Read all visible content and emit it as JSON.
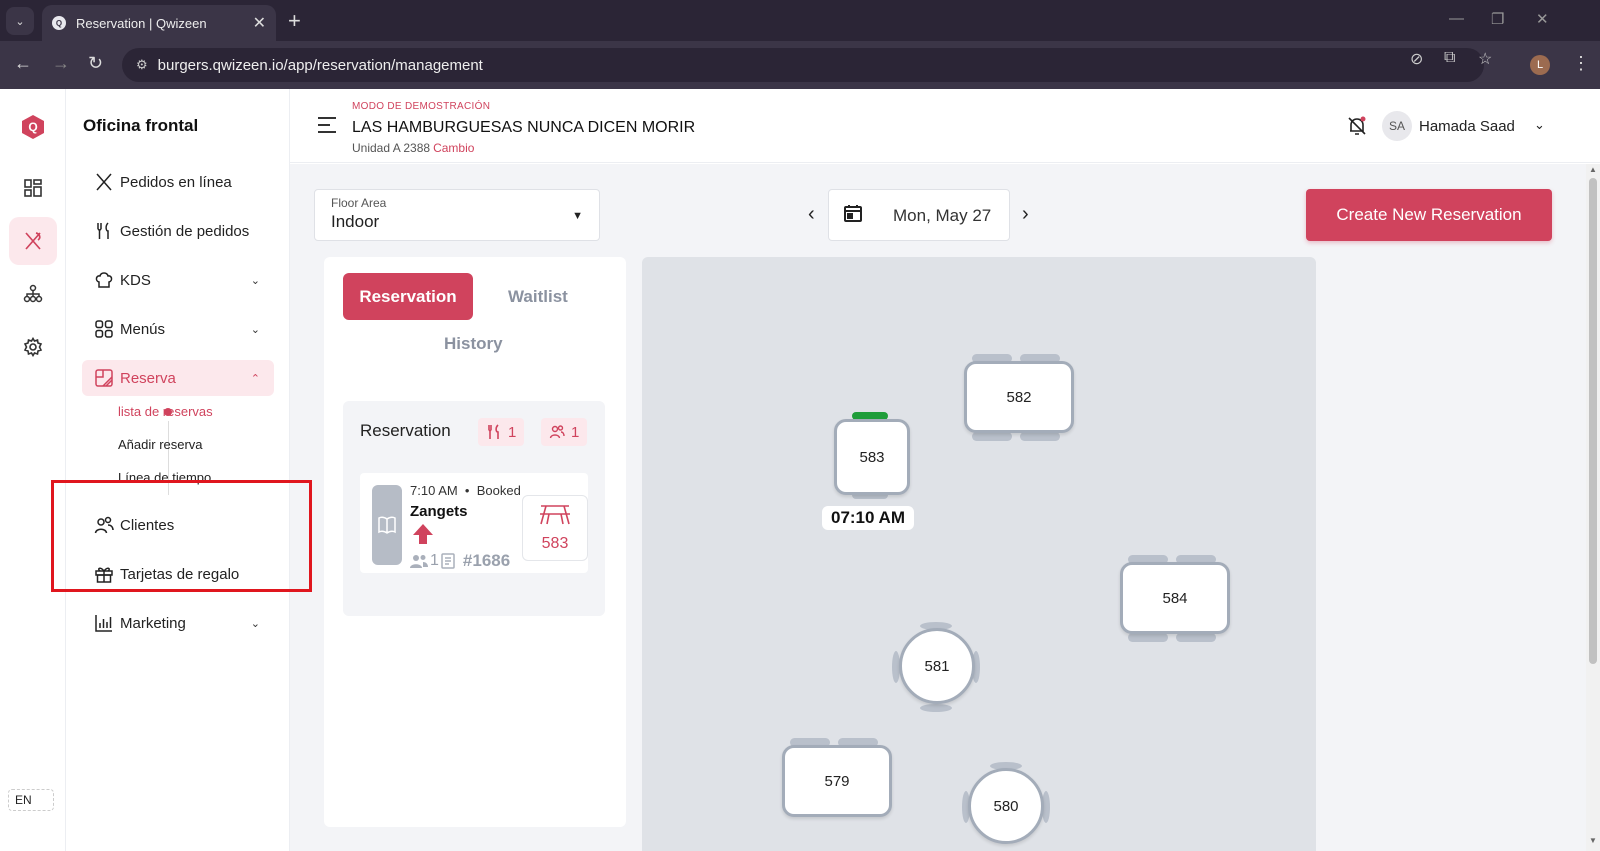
{
  "browser": {
    "tab_title": "Reservation | Qwizeen",
    "url": "burgers.qwizeen.io/app/reservation/management",
    "profile_initial": "L"
  },
  "rail": {
    "logo": "Q",
    "lang": "EN"
  },
  "sidenav": {
    "title": "Oficina frontal",
    "items": [
      {
        "label": "Pedidos en línea"
      },
      {
        "label": "Gestión de pedidos"
      },
      {
        "label": "KDS"
      },
      {
        "label": "Menús"
      },
      {
        "label": "Reserva"
      },
      {
        "label": "Clientes"
      },
      {
        "label": "Tarjetas de regalo"
      },
      {
        "label": "Marketing"
      }
    ],
    "sub_items": [
      {
        "label": "lista de reservas"
      },
      {
        "label": "Añadir reserva"
      },
      {
        "label": "Línea de tiempo"
      }
    ]
  },
  "header": {
    "demo_mode": "MODO DE DEMOSTRACIÓN",
    "business": "LAS HAMBURGUESAS NUNCA DICEN MORIR",
    "unit": "Unidad A 2388",
    "change": "Cambio",
    "user_initials": "SA",
    "user_name": "Hamada Saad"
  },
  "toolbar": {
    "floor_label": "Floor Area",
    "floor_value": "Indoor",
    "date": "Mon, May 27",
    "create_button": "Create New Reservation"
  },
  "list": {
    "tabs": [
      "Reservation",
      "Waitlist",
      "History"
    ],
    "group_title": "Reservation",
    "dine_count": "1",
    "guest_count": "1",
    "card": {
      "time": "7:10 AM",
      "status": "Booked",
      "name": "Zangets",
      "guests": "1",
      "order": "#1686",
      "table": "583"
    }
  },
  "floorplan": {
    "tables": [
      "582",
      "583",
      "584",
      "581",
      "579",
      "580"
    ],
    "time_label": "07:10 AM"
  },
  "colors": {
    "accent": "#d0435d",
    "accent_light": "#fce8ec",
    "occupied": "#1f9d3a"
  }
}
